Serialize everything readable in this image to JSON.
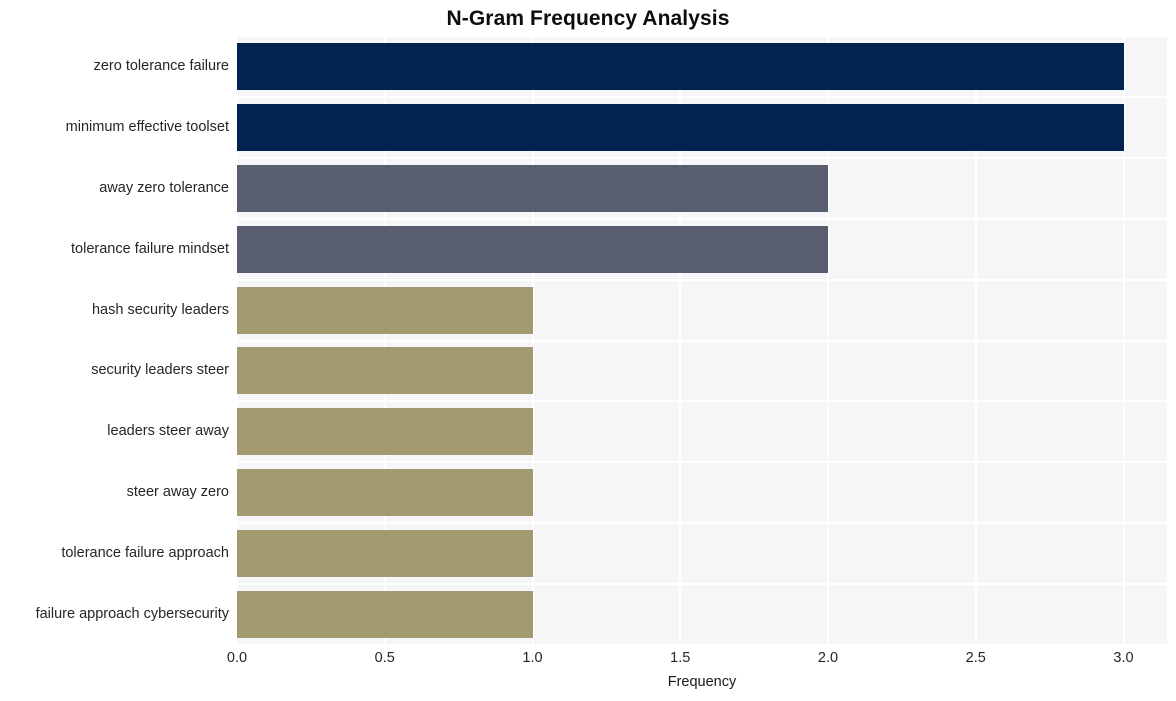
{
  "chart_data": {
    "type": "bar",
    "orientation": "horizontal",
    "title": "N-Gram Frequency Analysis",
    "xlabel": "Frequency",
    "ylabel": "",
    "xlim": [
      0.0,
      3.0
    ],
    "grid": true,
    "legend": false,
    "categories": [
      "zero tolerance failure",
      "minimum effective toolset",
      "away zero tolerance",
      "tolerance failure mindset",
      "hash security leaders",
      "security leaders steer",
      "leaders steer away",
      "steer away zero",
      "tolerance failure approach",
      "failure approach cybersecurity"
    ],
    "values": [
      3,
      3,
      2,
      2,
      1,
      1,
      1,
      1,
      1,
      1
    ],
    "bar_colors": [
      "#00234f",
      "#00234f",
      "#585d70",
      "#585d70",
      "#a39a72",
      "#a39a72",
      "#a39a72",
      "#a39a72",
      "#a39a72",
      "#a39a72"
    ],
    "xticks": [
      "0.0",
      "0.5",
      "1.0",
      "1.5",
      "2.0",
      "2.5",
      "3.0"
    ],
    "xtick_values": [
      0.0,
      0.5,
      1.0,
      1.5,
      2.0,
      2.5,
      3.0
    ],
    "plot_background": "#f6f6f8",
    "gridline_color": "#ffffff",
    "title_color": "#0d0d0d",
    "tick_label_color": "#262626"
  }
}
